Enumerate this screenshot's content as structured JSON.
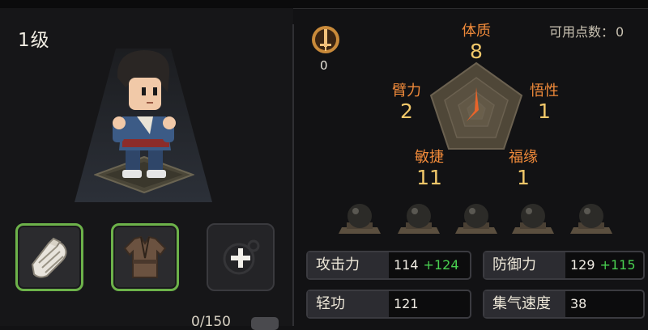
{
  "character": {
    "level": "1级"
  },
  "equipment": {
    "capacity": "0/150"
  },
  "power": {
    "icon": "sword-emblem-icon",
    "value": "0"
  },
  "points": {
    "label": "可用点数：",
    "value": "0"
  },
  "attributes": [
    {
      "name": "体质",
      "value": "8"
    },
    {
      "name": "悟性",
      "value": "1"
    },
    {
      "name": "福缘",
      "value": "1"
    },
    {
      "name": "敏捷",
      "value": "11"
    },
    {
      "name": "臂力",
      "value": "2"
    }
  ],
  "stats": [
    {
      "label": "攻击力",
      "value": "114",
      "bonus": "+124"
    },
    {
      "label": "防御力",
      "value": "129",
      "bonus": "+115"
    },
    {
      "label": "轻功",
      "value": "121",
      "bonus": ""
    },
    {
      "label": "集气速度",
      "value": "38",
      "bonus": ""
    }
  ],
  "colors": {
    "accent_orange": "#f08a3a",
    "value_gold": "#f2c86a",
    "bonus_green": "#49d050",
    "slot_border_green": "#6db24a"
  }
}
